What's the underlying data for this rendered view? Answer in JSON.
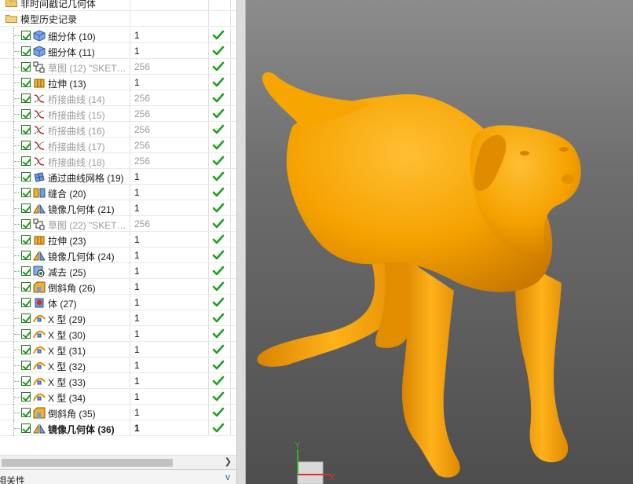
{
  "navigator": {
    "folders": [
      {
        "label": "非时间戳记几何体",
        "icon": "folder-icon"
      },
      {
        "label": "模型历史记录",
        "icon": "open-folder-icon"
      }
    ],
    "features": [
      {
        "name": "细分体 (10)",
        "value": "1",
        "icon": "subdivision-body-icon",
        "state": "normal"
      },
      {
        "name": "细分体 (11)",
        "value": "1",
        "icon": "subdivision-body-icon",
        "state": "normal"
      },
      {
        "name": "草图 (12) \"SKET…",
        "value": "256",
        "icon": "sketch-icon",
        "state": "dim"
      },
      {
        "name": "拉伸 (13)",
        "value": "1",
        "icon": "extrude-icon",
        "state": "normal"
      },
      {
        "name": "桥接曲线 (14)",
        "value": "256",
        "icon": "bridge-curve-icon",
        "state": "dim"
      },
      {
        "name": "桥接曲线 (15)",
        "value": "256",
        "icon": "bridge-curve-icon",
        "state": "dim"
      },
      {
        "name": "桥接曲线 (16)",
        "value": "256",
        "icon": "bridge-curve-icon",
        "state": "dim"
      },
      {
        "name": "桥接曲线 (17)",
        "value": "256",
        "icon": "bridge-curve-icon",
        "state": "dim"
      },
      {
        "name": "桥接曲线 (18)",
        "value": "256",
        "icon": "bridge-curve-icon",
        "state": "dim"
      },
      {
        "name": "通过曲线网格 (19)",
        "value": "1",
        "icon": "curve-mesh-icon",
        "state": "normal"
      },
      {
        "name": "缝合 (20)",
        "value": "1",
        "icon": "sew-icon",
        "state": "normal"
      },
      {
        "name": "镜像几何体 (21)",
        "value": "1",
        "icon": "mirror-geometry-icon",
        "state": "normal"
      },
      {
        "name": "草图 (22) \"SKET…",
        "value": "256",
        "icon": "sketch-icon",
        "state": "dim"
      },
      {
        "name": "拉伸 (23)",
        "value": "1",
        "icon": "extrude-icon",
        "state": "normal"
      },
      {
        "name": "镜像几何体 (24)",
        "value": "1",
        "icon": "mirror-geometry-icon",
        "state": "normal"
      },
      {
        "name": "减去 (25)",
        "value": "1",
        "icon": "subtract-icon",
        "state": "normal"
      },
      {
        "name": "倒斜角 (26)",
        "value": "1",
        "icon": "chamfer-icon",
        "state": "normal"
      },
      {
        "name": "体 (27)",
        "value": "1",
        "icon": "body-icon",
        "state": "normal"
      },
      {
        "name": "X 型 (29)",
        "value": "1",
        "icon": "x-form-icon",
        "state": "normal"
      },
      {
        "name": "X 型 (30)",
        "value": "1",
        "icon": "x-form-icon",
        "state": "normal"
      },
      {
        "name": "X 型 (31)",
        "value": "1",
        "icon": "x-form-icon",
        "state": "normal"
      },
      {
        "name": "X 型 (32)",
        "value": "1",
        "icon": "x-form-icon",
        "state": "normal"
      },
      {
        "name": "X 型 (33)",
        "value": "1",
        "icon": "x-form-icon",
        "state": "normal"
      },
      {
        "name": "X 型 (34)",
        "value": "1",
        "icon": "x-form-icon",
        "state": "normal"
      },
      {
        "name": "倒斜角 (35)",
        "value": "1",
        "icon": "chamfer-icon",
        "state": "normal"
      },
      {
        "name": "镜像几何体 (36)",
        "value": "1",
        "icon": "mirror-geometry-icon",
        "state": "current"
      }
    ],
    "status_icon": "green-check-icon",
    "bottom_panel_label": "相关性",
    "bottom_panel_chevron": "v"
  },
  "viewport": {
    "model": "dog-model",
    "model_color": "#ffa500",
    "triad": {
      "y_label": "Y",
      "x_label": "X",
      "y_color": "#2bb52b",
      "x_color": "#e03030"
    }
  }
}
